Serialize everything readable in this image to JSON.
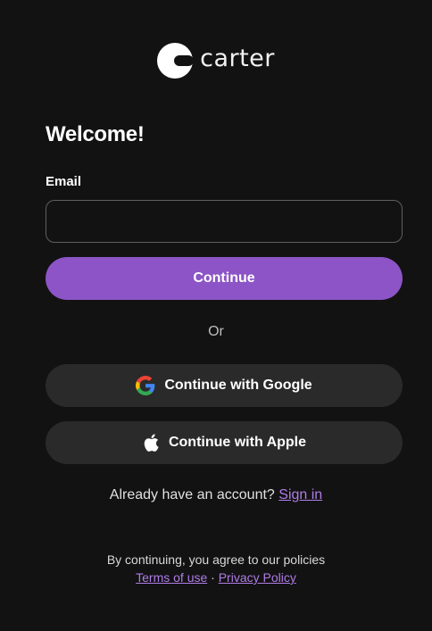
{
  "brand": {
    "name": "carter",
    "logo_icon": "carter-logo-icon"
  },
  "form": {
    "heading": "Welcome!",
    "email_label": "Email",
    "email_value": "",
    "email_placeholder": "",
    "continue_label": "Continue",
    "divider_text": "Or"
  },
  "social": {
    "google_label": "Continue with Google",
    "google_icon": "google-icon",
    "apple_label": "Continue with Apple",
    "apple_icon": "apple-icon"
  },
  "signin": {
    "prompt": "Already have an account?",
    "link_label": "Sign in"
  },
  "policies": {
    "notice": "By continuing, you agree to our policies",
    "terms_label": "Terms of use",
    "separator": "·",
    "privacy_label": "Privacy Policy"
  },
  "colors": {
    "background": "#121212",
    "primary": "#8c54c6",
    "secondary_button": "#2a2a2a",
    "link": "#b07ce6"
  }
}
